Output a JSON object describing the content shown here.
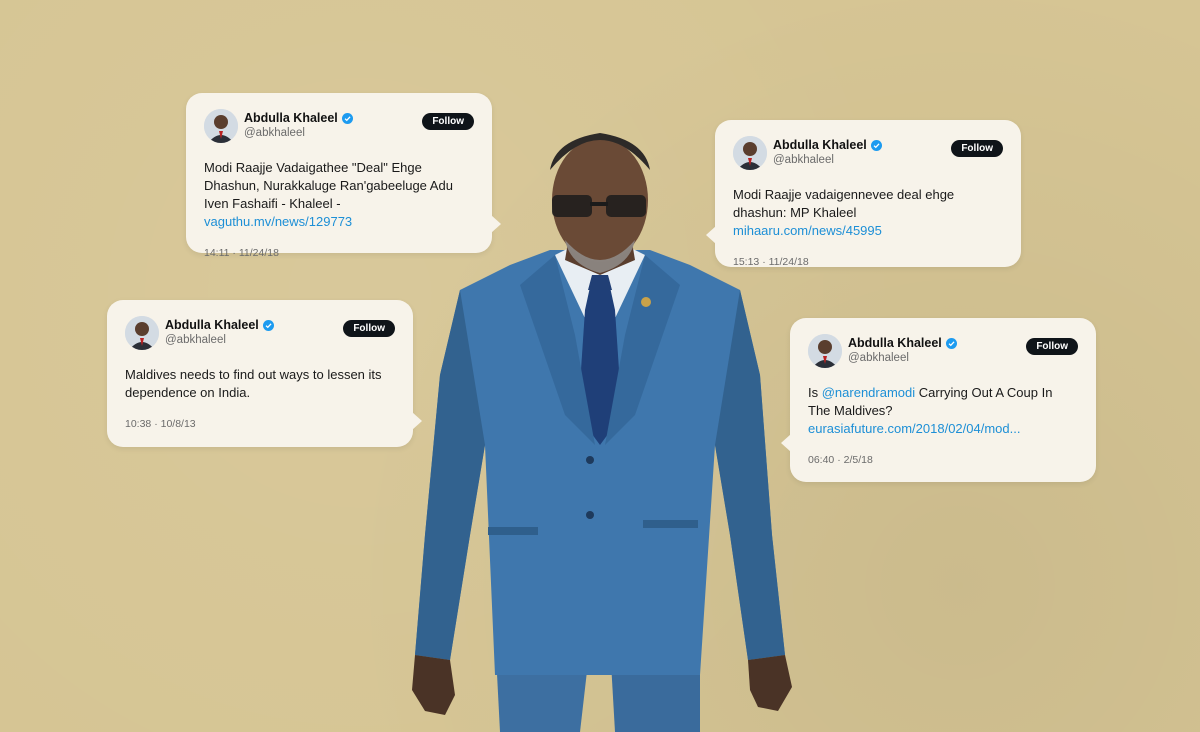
{
  "author": {
    "name": "Abdulla Khaleel",
    "handle": "@abkhaleel",
    "follow_label": "Follow"
  },
  "tweets": [
    {
      "text": "Modi Raajje Vadaigathee \"Deal\" Ehge Dhashun, Nurakkaluge Ran'gabeeluge Adu Iven Fashaifi - Khaleel - ",
      "link": "vaguthu.mv/news/129773",
      "time": "14:11 · 11/24/18"
    },
    {
      "text": "Modi Raajje vadaigennevee deal ehge dhashun: MP Khaleel ",
      "link": "mihaaru.com/news/45995",
      "time": "15:13 · 11/24/18"
    },
    {
      "text": "Maldives needs to find out ways to lessen its dependence on India.",
      "link": "",
      "time": "10:38 · 10/8/13"
    },
    {
      "text_prefix": "Is ",
      "mention": "@narendramodi",
      "text": " Carrying Out A Coup In The Maldives? ",
      "link": "eurasiafuture.com/2018/02/04/mod...",
      "time": "06:40 · 2/5/18"
    }
  ],
  "colors": {
    "background": "#d6c594",
    "card": "#f7f3ea",
    "link": "#1d8fd6",
    "verified": "#1d9bf0",
    "suit": "#3a6fa3"
  }
}
